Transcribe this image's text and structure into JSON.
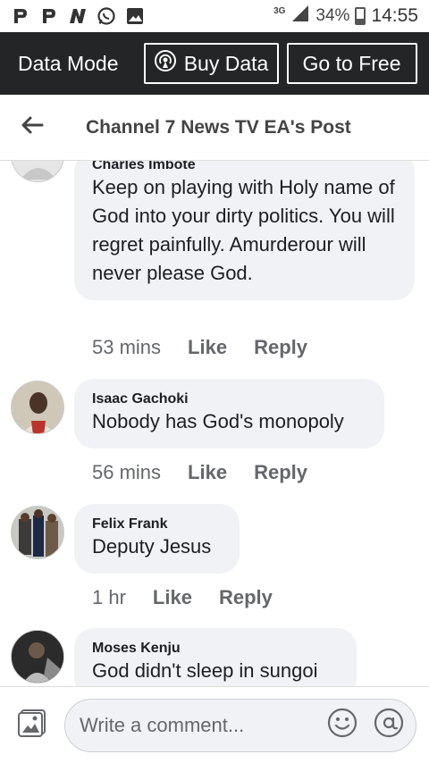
{
  "status_bar": {
    "left_icons": [
      "p-icon",
      "p-icon",
      "n-icon",
      "whatsapp-icon",
      "gallery-icon"
    ],
    "network": "3G",
    "battery": "34%",
    "time": "14:55"
  },
  "data_bar": {
    "title": "Data Mode",
    "buy_label": "Buy Data",
    "free_label": "Go to Free"
  },
  "header": {
    "title": "Channel 7 News TV EA's Post"
  },
  "comments": [
    {
      "name": "Charles Imbote",
      "text": "Keep on playing with Holy name of God into your dirty politics. You will regret painfully. Amurderour will never please God.",
      "time": "53 mins",
      "like": "Like",
      "reply": "Reply"
    },
    {
      "name": "Isaac Gachoki",
      "text": "Nobody has God's monopoly",
      "time": "56 mins",
      "like": "Like",
      "reply": "Reply"
    },
    {
      "name": "Felix Frank",
      "text": "Deputy Jesus",
      "time": "1 hr",
      "like": "Like",
      "reply": "Reply"
    },
    {
      "name": "Moses Kenju",
      "text": "God didn't sleep in sungoi",
      "time": "",
      "like": "",
      "reply": ""
    }
  ],
  "footer": {
    "placeholder": "Write a comment..."
  }
}
